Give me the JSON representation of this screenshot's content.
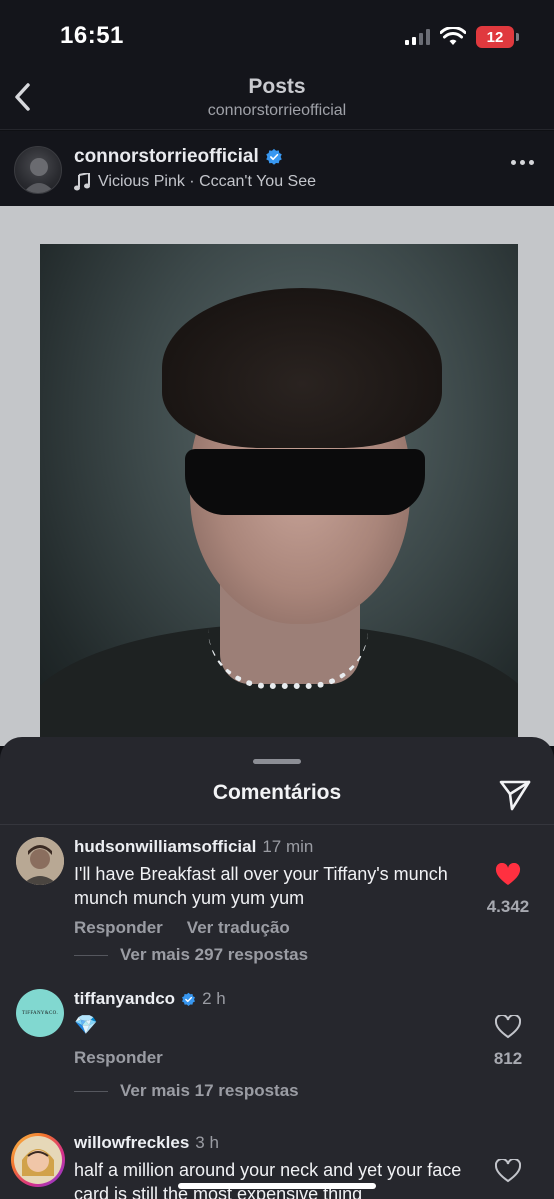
{
  "status_bar": {
    "time": "16:51",
    "battery": "12",
    "battery_color": "#e0393e"
  },
  "header": {
    "title": "Posts",
    "subtitle": "connorstorrieofficial",
    "back_icon": "chevron-left-icon"
  },
  "post": {
    "username": "connorstorrieofficial",
    "verified": true,
    "music": "Vicious Pink · Cccan't You See",
    "music_icon": "music-note-icon",
    "more_icon": "more-horizontal-icon"
  },
  "comments_sheet": {
    "title": "Comentários",
    "share_icon": "send-icon",
    "comments": [
      {
        "username": "hudsonwilliamsofficial",
        "verified": false,
        "time": "17 min",
        "text": "I'll have Breakfast all over your Tiffany's munch munch munch yum yum yum",
        "actions": [
          "Responder",
          "Ver tradução"
        ],
        "replies": "Ver mais 297 respostas",
        "liked": true,
        "likes": "4.342"
      },
      {
        "username": "tiffanyandco",
        "verified": true,
        "time": "2 h",
        "text": "💎",
        "actions": [
          "Responder"
        ],
        "replies": "Ver mais 17 respostas",
        "liked": false,
        "likes": "812",
        "avatar_text": "TIFFANY&CO."
      },
      {
        "username": "willowfreckles",
        "verified": false,
        "time": "3 h",
        "text": "half a million around your neck and yet your face card is still the most expensive thing",
        "liked": false
      }
    ]
  },
  "colors": {
    "background": "#0f1014",
    "sheet": "#26272d",
    "like_red": "#ff3040",
    "verified_blue": "#3897f0"
  }
}
